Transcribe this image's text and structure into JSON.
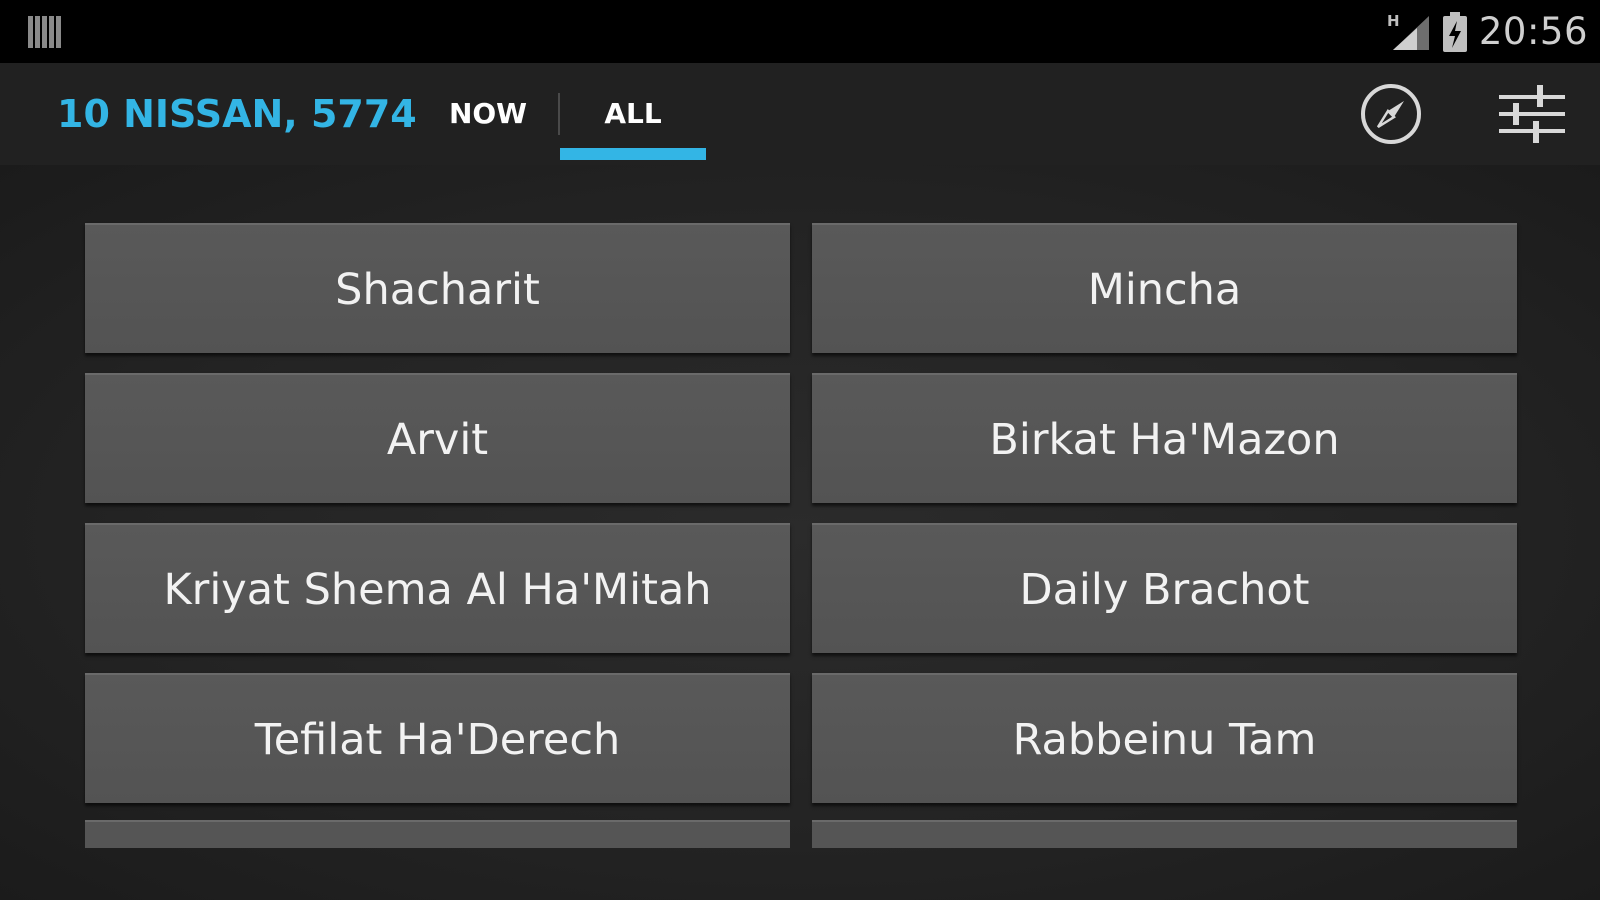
{
  "status_bar": {
    "time": "20:56",
    "network_type": "H",
    "icons": [
      "barcode-icon",
      "signal-icon",
      "battery-icon"
    ]
  },
  "action_bar": {
    "title": "10 NISSAN, 5774",
    "tabs": [
      {
        "label": "NOW",
        "selected": false
      },
      {
        "label": "ALL",
        "selected": true
      }
    ],
    "actions": [
      "compass-icon",
      "settings-sliders-icon"
    ],
    "accent_color": "#33b5e5"
  },
  "prayers": [
    {
      "label": "Shacharit"
    },
    {
      "label": "Mincha"
    },
    {
      "label": "Arvit"
    },
    {
      "label": "Birkat Ha'Mazon"
    },
    {
      "label": "Kriyat Shema Al Ha'Mitah"
    },
    {
      "label": "Daily Brachot"
    },
    {
      "label": "Tefilat Ha'Derech"
    },
    {
      "label": "Rabbeinu Tam"
    }
  ]
}
